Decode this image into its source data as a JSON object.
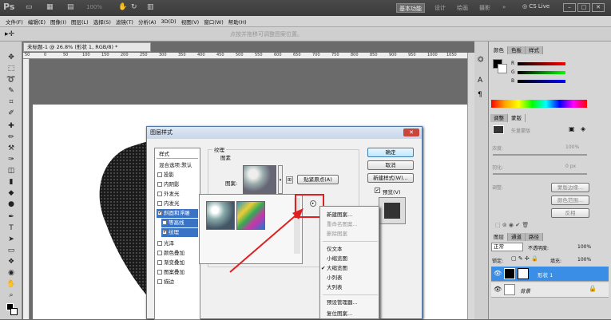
{
  "app": {
    "logo": "Ps",
    "zoom": "100%",
    "workspace": "基本功能",
    "workspaces": [
      "设计",
      "绘画",
      "摄影"
    ],
    "more": "»",
    "cslive": "CS Live"
  },
  "menu": [
    "文件(F)",
    "编辑(E)",
    "图像(I)",
    "图层(L)",
    "选择(S)",
    "滤镜(T)",
    "分析(A)",
    "3D(D)",
    "视图(V)",
    "窗口(W)",
    "帮助(H)"
  ],
  "options_hint": "点按并拖移可调整图案位置。",
  "document": {
    "tab": "未标题-1 @ 26.8% (形状 1, RGB/8) *",
    "ruler_numbers": [
      "50",
      "0",
      "50",
      "100",
      "150",
      "200",
      "250",
      "300",
      "350",
      "400",
      "450",
      "500",
      "550",
      "600",
      "650",
      "700",
      "750",
      "800",
      "850",
      "900",
      "950",
      "1000",
      "1050"
    ]
  },
  "right_panel": {
    "color_tabs": [
      "颜色",
      "色板",
      "样式"
    ],
    "color_sliders": [
      "R",
      "G",
      "B"
    ],
    "mask_tabs": [
      "调整",
      "蒙版"
    ],
    "mask_title": "矢量蒙版",
    "density_label": "浓度:",
    "density_value": "100%",
    "feather_label": "羽化:",
    "feather_value": "0 px",
    "refine_label": "调整:",
    "buttons": [
      "蒙版边缘...",
      "颜色范围...",
      "反相"
    ],
    "layer_tabs": [
      "图层",
      "通道",
      "路径"
    ],
    "blend_mode": "正常",
    "opacity_label": "不透明度:",
    "opacity_value": "100%",
    "lock_label": "锁定:",
    "fill_label": "填充:",
    "fill_value": "100%",
    "layers": [
      {
        "name": "形状 1"
      },
      {
        "name": "背景"
      }
    ]
  },
  "dialog": {
    "title": "图层样式",
    "close": "✕",
    "styles_header": "样式",
    "blend_options": "混合选项:默认",
    "style_items": [
      {
        "label": "投影",
        "checked": false
      },
      {
        "label": "内阴影",
        "checked": false
      },
      {
        "label": "外发光",
        "checked": false
      },
      {
        "label": "内发光",
        "checked": false
      },
      {
        "label": "斜面和浮雕",
        "checked": true
      },
      {
        "label": "等高线",
        "checked": false
      },
      {
        "label": "纹理",
        "checked": true
      },
      {
        "label": "光泽",
        "checked": false
      },
      {
        "label": "颜色叠加",
        "checked": false
      },
      {
        "label": "渐变叠加",
        "checked": false
      },
      {
        "label": "图案叠加",
        "checked": false
      },
      {
        "label": "描边",
        "checked": false
      }
    ],
    "group_title": "纹理",
    "sub_group": "图素",
    "pattern_label": "图案:",
    "snap_button": "贴紧原点(A)",
    "buttons": {
      "ok": "确定",
      "cancel": "取消",
      "new_style": "新建样式(W)...",
      "preview": "预览(V)"
    }
  },
  "context_menu": {
    "items": [
      {
        "label": "新建图案...",
        "disabled": false
      },
      {
        "label": "重命名图案...",
        "disabled": true
      },
      {
        "label": "删除图案",
        "disabled": true
      },
      {
        "label": "仅文本",
        "disabled": false
      },
      {
        "label": "小缩览图",
        "disabled": false
      },
      {
        "label": "大缩览图",
        "disabled": false,
        "checked": true
      },
      {
        "label": "小列表",
        "disabled": false
      },
      {
        "label": "大列表",
        "disabled": false
      },
      {
        "label": "预设管理器...",
        "disabled": false
      },
      {
        "label": "复位图案...",
        "disabled": false
      }
    ]
  },
  "colors": {
    "accent": "#3a72c4",
    "annotation": "#e02020",
    "layer_selected": "#3a8ee6"
  }
}
